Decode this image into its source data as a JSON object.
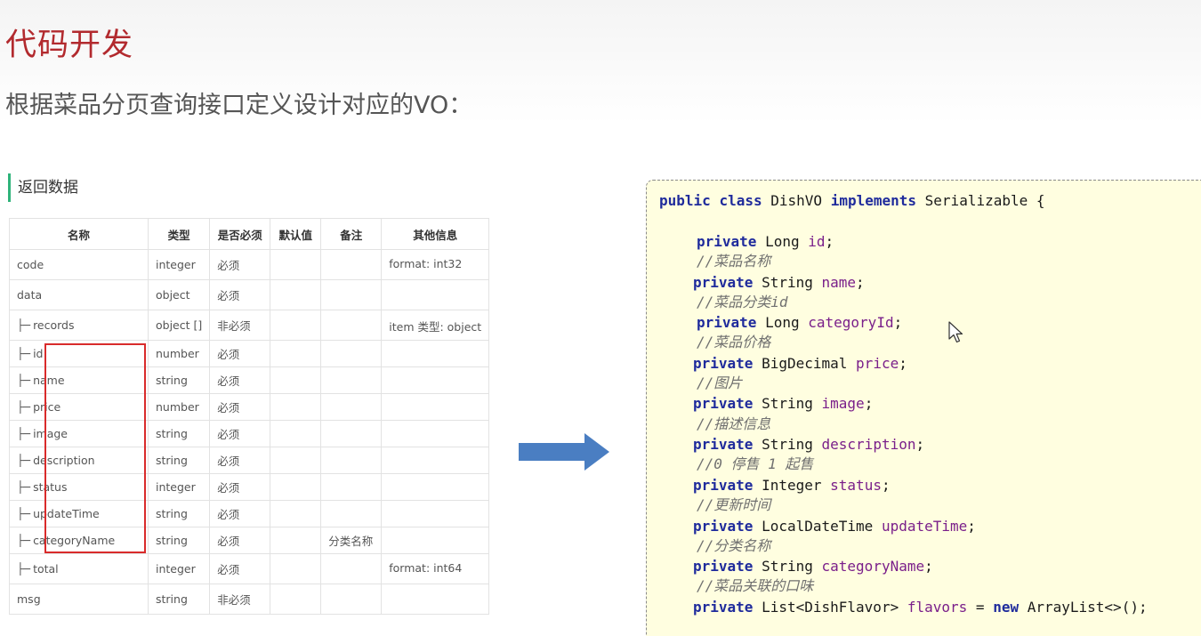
{
  "header": {
    "title": "代码开发",
    "subtitle": "根据菜品分页查询接口定义设计对应的VO："
  },
  "section": {
    "label": "返回数据"
  },
  "table": {
    "headers": [
      "名称",
      "类型",
      "是否必须",
      "默认值",
      "备注",
      "其他信息"
    ],
    "rows": [
      {
        "name": "code",
        "type": "integer",
        "required": "必须",
        "default": "",
        "note": "",
        "other": "format: int32"
      },
      {
        "name": "data",
        "type": "object",
        "required": "必须",
        "default": "",
        "note": "",
        "other": ""
      },
      {
        "name": "records",
        "type": "object []",
        "required": "非必须",
        "default": "",
        "note": "",
        "other": "item 类型: object"
      },
      {
        "name": "id",
        "type": "number",
        "required": "必须",
        "default": "",
        "note": "",
        "other": ""
      },
      {
        "name": "name",
        "type": "string",
        "required": "必须",
        "default": "",
        "note": "",
        "other": ""
      },
      {
        "name": "price",
        "type": "number",
        "required": "必须",
        "default": "",
        "note": "",
        "other": ""
      },
      {
        "name": "image",
        "type": "string",
        "required": "必须",
        "default": "",
        "note": "",
        "other": ""
      },
      {
        "name": "description",
        "type": "string",
        "required": "必须",
        "default": "",
        "note": "",
        "other": ""
      },
      {
        "name": "status",
        "type": "integer",
        "required": "必须",
        "default": "",
        "note": "",
        "other": ""
      },
      {
        "name": "updateTime",
        "type": "string",
        "required": "必须",
        "default": "",
        "note": "",
        "other": ""
      },
      {
        "name": "categoryName",
        "type": "string",
        "required": "必须",
        "default": "",
        "note": "分类名称",
        "other": ""
      },
      {
        "name": "total",
        "type": "integer",
        "required": "必须",
        "default": "",
        "note": "",
        "other": "format: int64"
      },
      {
        "name": "msg",
        "type": "string",
        "required": "非必须",
        "default": "",
        "note": "",
        "other": ""
      }
    ]
  },
  "code": {
    "class_decl": {
      "kw1": "public",
      "kw2": "class",
      "name": "DishVO",
      "kw3": "implements",
      "iface": "Serializable",
      "brace": "{"
    },
    "lines": [
      {
        "kind": "field",
        "type": "Long",
        "name": "id",
        "tail": ";"
      },
      {
        "kind": "comment",
        "text": "//菜品名称"
      },
      {
        "kind": "field",
        "type": "String",
        "name": "name",
        "tail": ";"
      },
      {
        "kind": "comment",
        "text": "//菜品分类id"
      },
      {
        "kind": "field",
        "type": "Long",
        "name": "categoryId",
        "tail": ";"
      },
      {
        "kind": "comment",
        "text": "//菜品价格"
      },
      {
        "kind": "field",
        "type": "BigDecimal",
        "name": "price",
        "tail": ";"
      },
      {
        "kind": "comment",
        "text": "//图片"
      },
      {
        "kind": "field",
        "type": "String",
        "name": "image",
        "tail": ";"
      },
      {
        "kind": "comment",
        "text": "//描述信息"
      },
      {
        "kind": "field",
        "type": "String",
        "name": "description",
        "tail": ";"
      },
      {
        "kind": "comment",
        "text": "//0 停售 1 起售"
      },
      {
        "kind": "field",
        "type": "Integer",
        "name": "status",
        "tail": ";"
      },
      {
        "kind": "comment",
        "text": "//更新时间"
      },
      {
        "kind": "field",
        "type": "LocalDateTime",
        "name": "updateTime",
        "tail": ";"
      },
      {
        "kind": "comment",
        "text": "//分类名称"
      },
      {
        "kind": "field",
        "type": "String",
        "name": "categoryName",
        "tail": ";"
      },
      {
        "kind": "comment",
        "text": "//菜品关联的口味"
      },
      {
        "kind": "field",
        "type": "List<DishFlavor>",
        "name": "flavors",
        "eq": " = ",
        "newkw": "new",
        "tail": " ArrayList<>();"
      }
    ],
    "keyword_private": "private"
  },
  "colors": {
    "title": "#b22a2e",
    "section_bar": "#2fb37a",
    "highlight_box": "#d92b2b",
    "arrow": "#4a7ec2",
    "code_bg": "#fffee0",
    "keyword": "#1f2b9c",
    "field": "#7a1f8a",
    "comment": "#707070"
  },
  "icons": {
    "arrow": "right-arrow-icon",
    "cursor": "mouse-pointer-icon"
  }
}
